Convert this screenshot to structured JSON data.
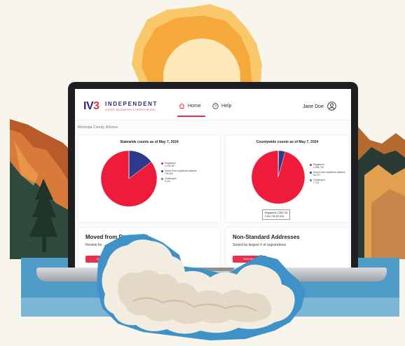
{
  "header": {
    "logo_iv": "IV",
    "logo_three": "3",
    "logo_name": "INDEPENDENT",
    "logo_tagline": "VOTER VALIDATION & VERIFICATION",
    "nav_home": "Home",
    "nav_help": "Help",
    "user_name": "Jane Doe"
  },
  "breadcrumb": "Maricopa County, Arizona",
  "statewide_card": {
    "title": "Statewide counts as of May 7, 2024",
    "legend": [
      {
        "label": "Registered",
        "value": "4,109,357",
        "color": "#ee1c3a"
      },
      {
        "label": "Moved from registered address",
        "value": "709,362",
        "color": "#2d3a8c"
      },
      {
        "label": "Challenged",
        "value": "2,151",
        "color": "#4b7bd1"
      }
    ]
  },
  "countywide_card": {
    "title": "Countywide counts as of May 7, 2024",
    "legend": [
      {
        "label": "Registered",
        "value": "2,353,735",
        "color": "#ee1c3a"
      },
      {
        "label": "Moved from registered address",
        "value": "96,797",
        "color": "#2d3a8c"
      },
      {
        "label": "Challenged",
        "value": "7,715",
        "color": "#4b7bd1"
      }
    ],
    "tooltip_line1": "Registered: 2,353,735",
    "tooltip_line2": "2,901,735 (97.8%)"
  },
  "moved_card": {
    "title": "Moved from Registered",
    "subtitle": "Review for ...",
    "button": "View"
  },
  "nonstandard_card": {
    "title": "Non-Standard Addresses",
    "subtitle": "Sorted by largest # of registrations",
    "button": "View Now"
  },
  "colors": {
    "brand_navy": "#2d2a7a",
    "brand_red": "#e8304a",
    "sun": "#f6b43f",
    "lake": "#4f9cc8"
  },
  "chart_data": [
    {
      "type": "pie",
      "title": "Statewide counts as of May 7, 2024",
      "categories": [
        "Registered",
        "Moved from registered address",
        "Challenged"
      ],
      "values": [
        4109357,
        709362,
        2151
      ]
    },
    {
      "type": "pie",
      "title": "Countywide counts as of May 7, 2024",
      "categories": [
        "Registered",
        "Moved from registered address",
        "Challenged"
      ],
      "values": [
        2353735,
        96797,
        7715
      ]
    }
  ]
}
